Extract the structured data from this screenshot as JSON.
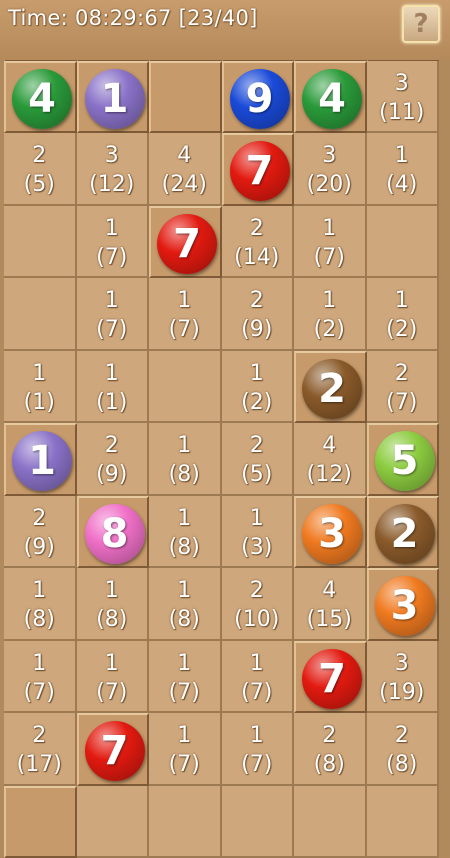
{
  "header": {
    "timer": "Time: 08:29:67  [23/40]",
    "help_label": "?"
  },
  "colors": {
    "1": "#8a72c8",
    "2": "#8a5a2a",
    "3": "#f07a20",
    "4": "#2a9a3a",
    "5": "#8ccc40",
    "7": "#e21a10",
    "8": "#f070c8",
    "9": "#1a4ad8"
  },
  "board": {
    "rows": [
      [
        {
          "tile": true
        },
        {
          "tile": true
        },
        {
          "tile": true
        },
        {
          "tile": true
        },
        {
          "tile": true
        },
        {
          "tile": true
        }
      ],
      [
        {
          "ball": "4"
        },
        {
          "ball": "1"
        },
        {
          "tile": true
        },
        {
          "ball": "9"
        },
        {
          "ball": "4"
        },
        {
          "hint": "3\n(11)"
        }
      ],
      [
        {
          "hint": "2\n(5)"
        },
        {
          "hint": "3\n(12)"
        },
        {
          "hint": "4\n(24)"
        },
        {
          "ball": "7"
        },
        {
          "hint": "3\n(20)"
        },
        {
          "hint": "1\n(4)"
        }
      ],
      [
        {},
        {
          "hint": "1\n(7)"
        },
        {
          "ball": "7"
        },
        {
          "hint": "2\n(14)"
        },
        {
          "hint": "1\n(7)"
        },
        {}
      ],
      [
        {},
        {
          "hint": "1\n(7)"
        },
        {
          "hint": "1\n(7)"
        },
        {
          "hint": "2\n(9)"
        },
        {
          "hint": "1\n(2)"
        },
        {
          "hint": "1\n(2)"
        }
      ],
      [
        {
          "hint": "1\n(1)"
        },
        {
          "hint": "1\n(1)"
        },
        {},
        {
          "hint": "1\n(2)"
        },
        {
          "ball": "2"
        },
        {
          "hint": "2\n(7)"
        }
      ],
      [
        {
          "ball": "1"
        },
        {
          "hint": "2\n(9)"
        },
        {
          "hint": "1\n(8)"
        },
        {
          "hint": "2\n(5)"
        },
        {
          "hint": "4\n(12)"
        },
        {
          "ball": "5"
        }
      ],
      [
        {
          "hint": "2\n(9)"
        },
        {
          "ball": "8"
        },
        {
          "hint": "1\n(8)"
        },
        {
          "hint": "1\n(3)"
        },
        {
          "ball": "3"
        },
        {
          "ball": "2"
        }
      ],
      [
        {
          "hint": "1\n(8)"
        },
        {
          "hint": "1\n(8)"
        },
        {
          "hint": "1\n(8)"
        },
        {
          "hint": "2\n(10)"
        },
        {
          "hint": "4\n(15)"
        },
        {
          "ball": "3"
        }
      ],
      [
        {
          "hint": "1\n(7)"
        },
        {
          "hint": "1\n(7)"
        },
        {
          "hint": "1\n(7)"
        },
        {
          "hint": "1\n(7)"
        },
        {
          "ball": "7"
        },
        {
          "hint": "3\n(19)"
        }
      ],
      [
        {
          "hint": "2\n(17)"
        },
        {
          "ball": "7"
        },
        {
          "hint": "1\n(7)"
        },
        {
          "hint": "1\n(7)"
        },
        {
          "hint": "2\n(8)"
        },
        {
          "hint": "2\n(8)"
        }
      ],
      [
        {
          "tile": true
        },
        {},
        {},
        {},
        {},
        {}
      ]
    ]
  }
}
